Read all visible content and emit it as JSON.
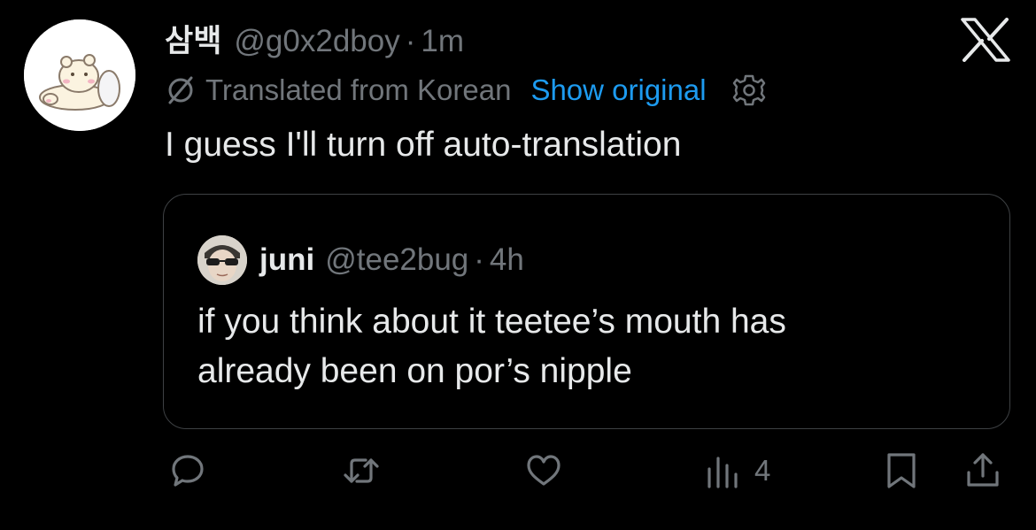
{
  "tweet": {
    "display_name": "삼백",
    "handle": "@g0x2dboy",
    "separator": "·",
    "time": "1m",
    "translated_label": "Translated from Korean",
    "show_original_label": "Show original",
    "text": "I guess I'll turn off auto-translation"
  },
  "quote": {
    "display_name": "juni",
    "handle": "@tee2bug",
    "separator": "·",
    "time": "4h",
    "lines": [
      "if you think about it teetee’s mouth has",
      "already been on por’s nipple"
    ]
  },
  "actions": {
    "views_count": "4"
  },
  "icons": {
    "close": "x-logo-icon",
    "translate": "translate-slash-icon",
    "settings": "gear-icon",
    "reply": "reply-icon",
    "retweet": "retweet-icon",
    "like": "heart-icon",
    "views": "views-icon",
    "bookmark": "bookmark-icon",
    "share": "share-icon"
  },
  "colors": {
    "background": "#000000",
    "text": "#e7e9ea",
    "secondary": "#71767b",
    "link": "#1d9bf0",
    "border": "#3e4144"
  }
}
